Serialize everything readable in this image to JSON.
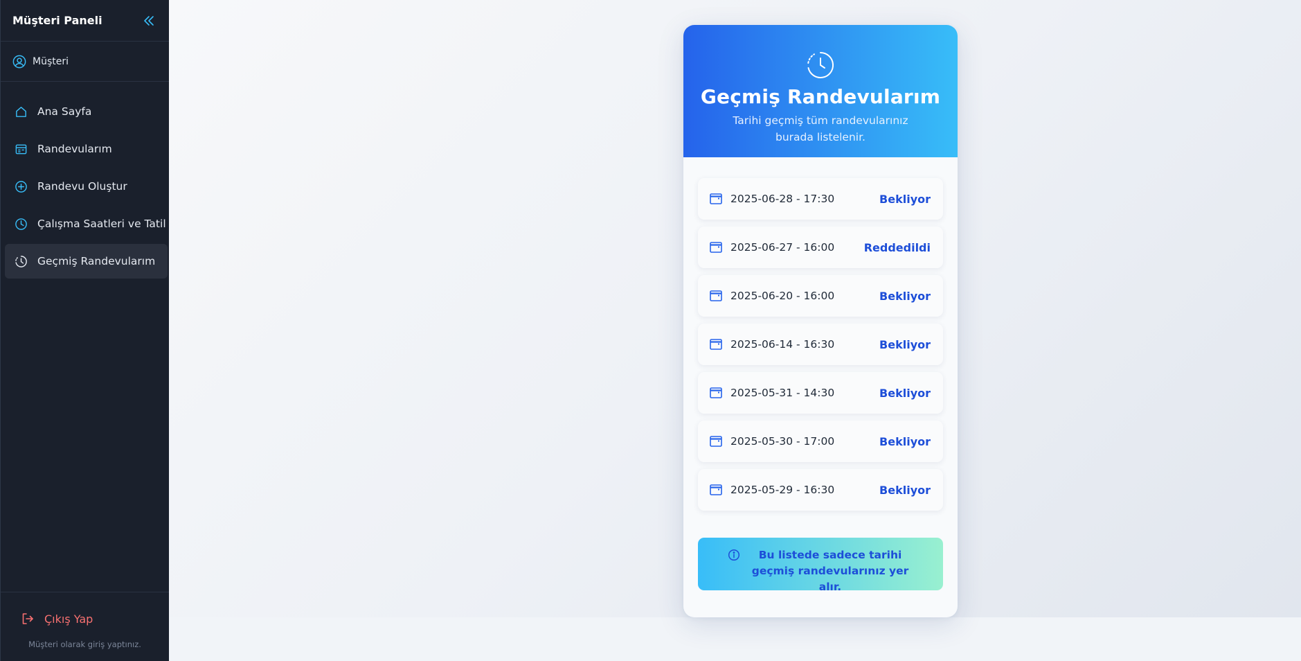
{
  "sidebar": {
    "title": "Müşteri Paneli",
    "user": {
      "name": "Müşteri"
    },
    "items": [
      {
        "label": "Ana Sayfa",
        "icon": "home-icon"
      },
      {
        "label": "Randevularım",
        "icon": "calendar-list-icon"
      },
      {
        "label": "Randevu Oluştur",
        "icon": "plus-circle-icon"
      },
      {
        "label": "Çalışma Saatleri ve Tatil",
        "icon": "clock-icon"
      },
      {
        "label": "Geçmiş Randevularım",
        "icon": "history-icon",
        "active": true
      }
    ],
    "logout_label": "Çıkış Yap",
    "footer_note": "Müşteri olarak giriş yaptınız."
  },
  "card": {
    "title": "Geçmiş Randevularım",
    "subtitle": "Tarihi geçmiş tüm randevularınız burada listelenir.",
    "appointments": [
      {
        "datetime": "2025-06-28 - 17:30",
        "status": "Bekliyor"
      },
      {
        "datetime": "2025-06-27 - 16:00",
        "status": "Reddedildi"
      },
      {
        "datetime": "2025-06-20 - 16:00",
        "status": "Bekliyor"
      },
      {
        "datetime": "2025-06-14 - 16:30",
        "status": "Bekliyor"
      },
      {
        "datetime": "2025-05-31 - 14:30",
        "status": "Bekliyor"
      },
      {
        "datetime": "2025-05-30 - 17:00",
        "status": "Bekliyor"
      },
      {
        "datetime": "2025-05-29 - 16:30",
        "status": "Bekliyor"
      }
    ],
    "info_text": "Bu listede sadece tarihi geçmiş randevularınız yer alır."
  },
  "colors": {
    "sidebar_bg": "#1a202c",
    "accent_blue": "#2563eb",
    "accent_sky": "#38bdf8",
    "status_text": "#1d4ed8",
    "logout_red": "#f87171"
  }
}
